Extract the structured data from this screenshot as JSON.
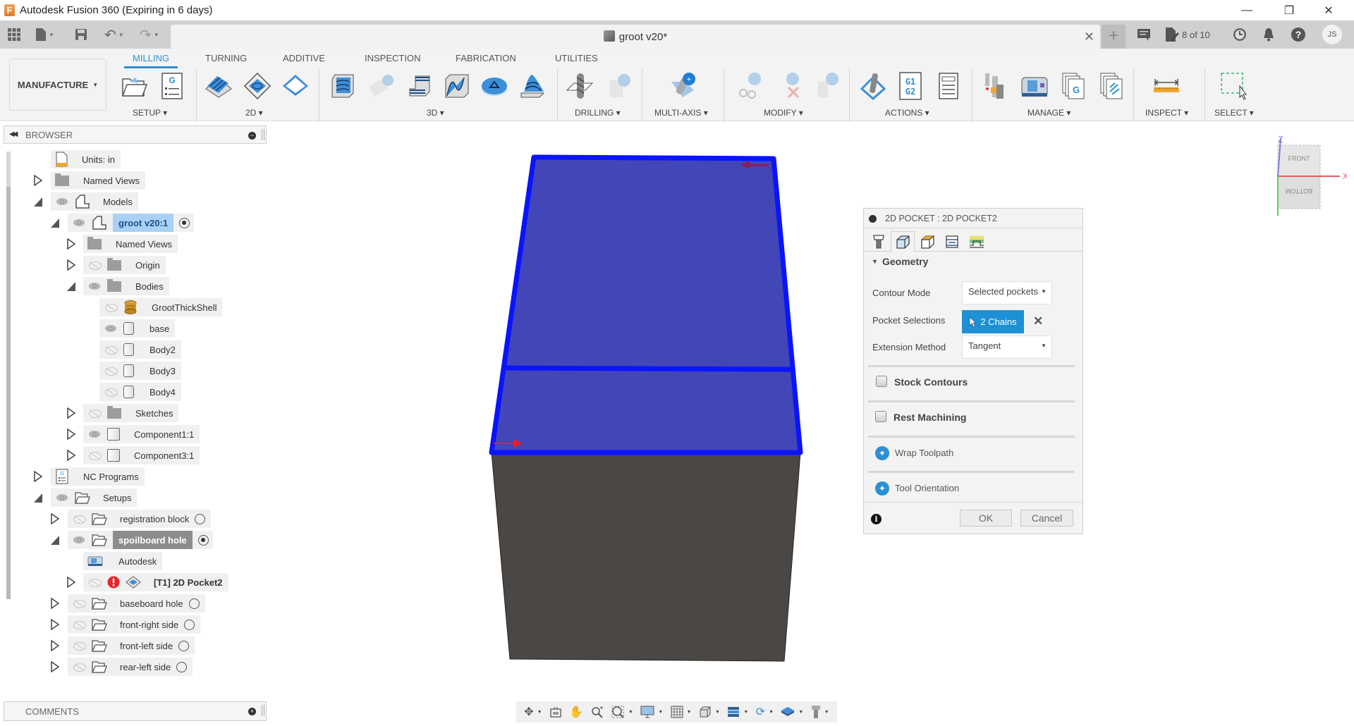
{
  "window": {
    "title": "Autodesk Fusion 360 (Expiring in 6 days)",
    "controls": {
      "minimize": "—",
      "maximize": "❐",
      "close": "✕"
    }
  },
  "quick_access": {
    "document_title": "groot v20*",
    "close_tab": "✕",
    "new_tab": "+",
    "job_status": "8 of 10",
    "avatar_initials": "JS"
  },
  "ribbon": {
    "workspace": "MANUFACTURE",
    "tabs": [
      {
        "label": "MILLING",
        "active": true
      },
      {
        "label": "TURNING",
        "active": false
      },
      {
        "label": "ADDITIVE",
        "active": false
      },
      {
        "label": "INSPECTION",
        "active": false
      },
      {
        "label": "FABRICATION",
        "active": false
      },
      {
        "label": "UTILITIES",
        "active": false
      }
    ],
    "groups": [
      {
        "label": "SETUP ▾"
      },
      {
        "label": "2D ▾"
      },
      {
        "label": "3D ▾"
      },
      {
        "label": "DRILLING ▾"
      },
      {
        "label": "MULTI-AXIS ▾"
      },
      {
        "label": "MODIFY ▾"
      },
      {
        "label": "ACTIONS ▾"
      },
      {
        "label": "MANAGE ▾"
      },
      {
        "label": "INSPECT ▾"
      },
      {
        "label": "SELECT ▾"
      }
    ],
    "actions_g1g2": "G1 G2",
    "setup_g": "G",
    "manage_g": "G"
  },
  "browser": {
    "title": "BROWSER",
    "items": [
      {
        "label": "Units: in"
      },
      {
        "label": "Named Views"
      },
      {
        "label": "Models"
      },
      {
        "label": "groot v20:1"
      },
      {
        "label": "Named Views"
      },
      {
        "label": "Origin"
      },
      {
        "label": "Bodies"
      },
      {
        "label": "GrootThickShell"
      },
      {
        "label": "base"
      },
      {
        "label": "Body2"
      },
      {
        "label": "Body3"
      },
      {
        "label": "Body4"
      },
      {
        "label": "Sketches"
      },
      {
        "label": "Component1:1"
      },
      {
        "label": "Component3:1"
      },
      {
        "label": "NC Programs"
      },
      {
        "label": "Setups"
      },
      {
        "label": "registration block"
      },
      {
        "label": "spoilboard hole"
      },
      {
        "label": "Autodesk"
      },
      {
        "label": "[T1] 2D Pocket2"
      },
      {
        "label": "baseboard hole"
      },
      {
        "label": "front-right side"
      },
      {
        "label": "front-left side"
      },
      {
        "label": "rear-left side"
      }
    ]
  },
  "comments": {
    "title": "COMMENTS"
  },
  "dialog": {
    "title": "2D POCKET : 2D POCKET2",
    "section_geometry": "Geometry",
    "contour_mode_label": "Contour Mode",
    "contour_mode_value": "Selected pockets",
    "pocket_selections_label": "Pocket Selections",
    "pocket_selections_value": "2 Chains",
    "extension_method_label": "Extension Method",
    "extension_method_value": "Tangent",
    "stock_contours": {
      "label": "Stock Contours",
      "checked": false
    },
    "rest_machining": {
      "label": "Rest Machining",
      "checked": false
    },
    "wrap_toolpath": "Wrap Toolpath",
    "tool_orientation": "Tool Orientation",
    "ok": "OK",
    "cancel": "Cancel"
  },
  "viewcube": {
    "face_front": "FRONT",
    "face_bottom": "BOTTOM",
    "axis_x": "X",
    "axis_z": "Z"
  },
  "colors": {
    "accent": "#2b8fd6",
    "selection_blue": "#1e90d6",
    "model_face": "#4548b8",
    "model_edge": "#0a14ff",
    "model_side": "#4a4744",
    "error_red": "#e8242c"
  }
}
